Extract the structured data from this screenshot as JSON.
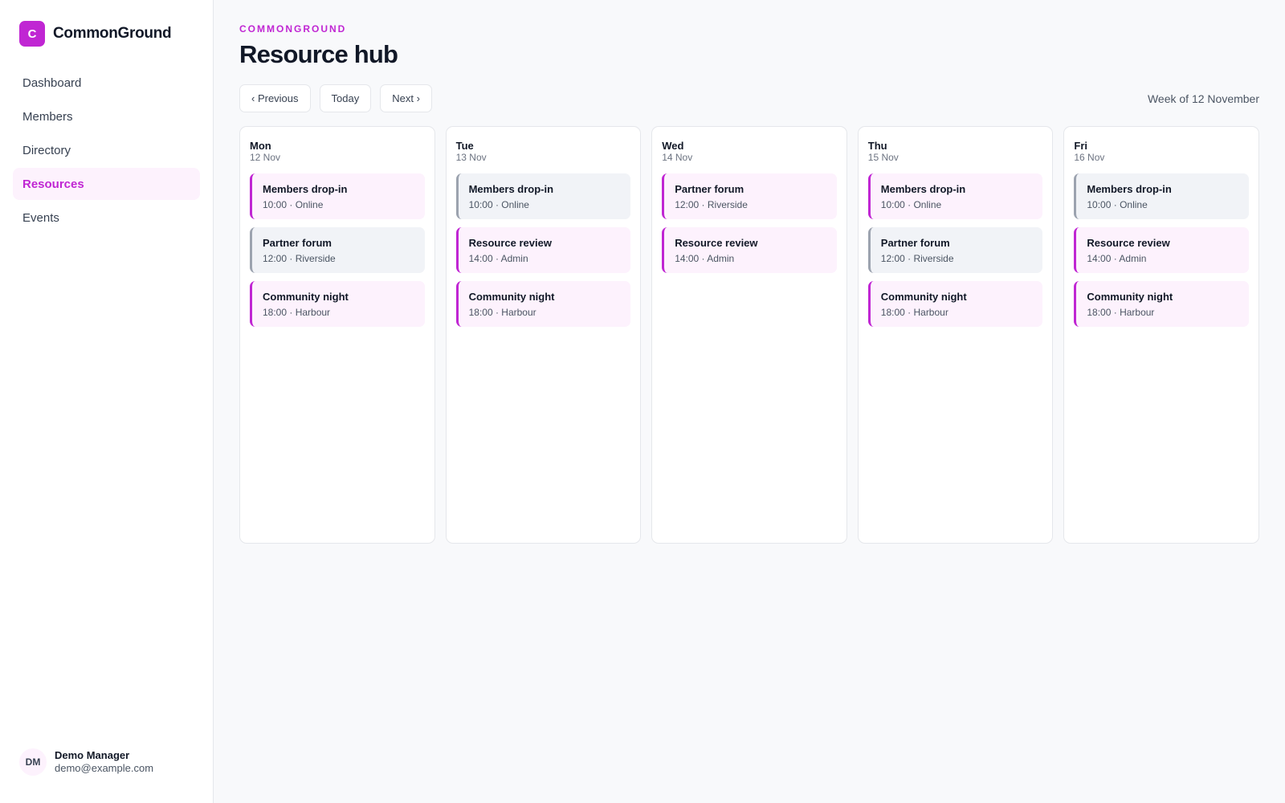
{
  "brand": {
    "logo_letter": "C",
    "name": "CommonGround"
  },
  "nav": [
    {
      "label": "Dashboard",
      "active": false
    },
    {
      "label": "Members",
      "active": false
    },
    {
      "label": "Directory",
      "active": false
    },
    {
      "label": "Resources",
      "active": true
    },
    {
      "label": "Events",
      "active": false
    }
  ],
  "user": {
    "initials": "DM",
    "name": "Demo Manager",
    "email": "demo@example.com"
  },
  "header": {
    "eyebrow": "COMMONGROUND",
    "title": "Resource hub"
  },
  "toolbar": {
    "previous": "‹ Previous",
    "today": "Today",
    "next": "Next ›",
    "week_label": "Week of 12 November"
  },
  "colors": {
    "accent": "#c026d3",
    "accent_bg": "#fdf2fd",
    "muted_bg": "#f1f3f7",
    "muted_border": "#9ca3af"
  },
  "days": [
    {
      "name": "Mon",
      "date": "12 Nov",
      "events": [
        {
          "title": "Members drop-in",
          "meta": "10:00 · Online",
          "style": "accent"
        },
        {
          "title": "Partner forum",
          "meta": "12:00 · Riverside",
          "style": "muted"
        },
        {
          "title": "Community night",
          "meta": "18:00 · Harbour",
          "style": "accent"
        }
      ]
    },
    {
      "name": "Tue",
      "date": "13 Nov",
      "events": [
        {
          "title": "Members drop-in",
          "meta": "10:00 · Online",
          "style": "muted"
        },
        {
          "title": "Resource review",
          "meta": "14:00 · Admin",
          "style": "accent"
        },
        {
          "title": "Community night",
          "meta": "18:00 · Harbour",
          "style": "accent"
        }
      ]
    },
    {
      "name": "Wed",
      "date": "14 Nov",
      "events": [
        {
          "title": "Partner forum",
          "meta": "12:00 · Riverside",
          "style": "accent"
        },
        {
          "title": "Resource review",
          "meta": "14:00 · Admin",
          "style": "accent"
        }
      ]
    },
    {
      "name": "Thu",
      "date": "15 Nov",
      "events": [
        {
          "title": "Members drop-in",
          "meta": "10:00 · Online",
          "style": "accent"
        },
        {
          "title": "Partner forum",
          "meta": "12:00 · Riverside",
          "style": "muted"
        },
        {
          "title": "Community night",
          "meta": "18:00 · Harbour",
          "style": "accent"
        }
      ]
    },
    {
      "name": "Fri",
      "date": "16 Nov",
      "events": [
        {
          "title": "Members drop-in",
          "meta": "10:00 · Online",
          "style": "muted"
        },
        {
          "title": "Resource review",
          "meta": "14:00 · Admin",
          "style": "accent"
        },
        {
          "title": "Community night",
          "meta": "18:00 · Harbour",
          "style": "accent"
        }
      ]
    }
  ]
}
